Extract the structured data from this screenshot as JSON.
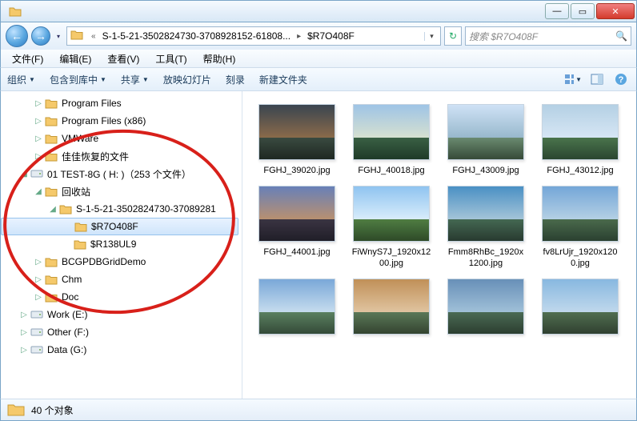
{
  "titlebar": {
    "close": "✕",
    "max": "▭",
    "min": "—"
  },
  "nav": {
    "back": "←",
    "fwd": "→",
    "dropdown": "▾",
    "refresh": "↻",
    "path_sep": "▸",
    "address_parts": [
      "S-1-5-21-3502824730-3708928152-61808...",
      "$R7O408F"
    ],
    "address_dd": "▾"
  },
  "search": {
    "placeholder": "搜索 $R7O408F",
    "icon": "🔍"
  },
  "menu": {
    "file": "文件(F)",
    "edit": "编辑(E)",
    "view": "查看(V)",
    "tools": "工具(T)",
    "help": "帮助(H)"
  },
  "toolbar": {
    "organize": "组织",
    "include": "包含到库中",
    "share": "共享",
    "slideshow": "放映幻灯片",
    "burn": "刻录",
    "newfolder": "新建文件夹",
    "dd": "▼"
  },
  "tree": [
    {
      "indent": 1,
      "expander": "▷",
      "icon": "folder",
      "label": "Program Files"
    },
    {
      "indent": 1,
      "expander": "▷",
      "icon": "folder",
      "label": "Program Files (x86)"
    },
    {
      "indent": 1,
      "expander": "▷",
      "icon": "folder",
      "label": "VMWare"
    },
    {
      "indent": 1,
      "expander": "▷",
      "icon": "folder",
      "label": "佳佳恢复的文件"
    },
    {
      "indent": 0,
      "expander": "◢",
      "icon": "drive",
      "label": "01 TEST-8G ( H: )（253 个文件）"
    },
    {
      "indent": 1,
      "expander": "◢",
      "icon": "folder",
      "label": "回收站"
    },
    {
      "indent": 2,
      "expander": "◢",
      "icon": "folder",
      "label": "S-1-5-21-3502824730-37089281"
    },
    {
      "indent": 3,
      "expander": "",
      "icon": "folder",
      "label": "$R7O408F",
      "selected": true
    },
    {
      "indent": 3,
      "expander": "",
      "icon": "folder",
      "label": "$R138UL9"
    },
    {
      "indent": 1,
      "expander": "▷",
      "icon": "folder",
      "label": "BCGPDBGridDemo"
    },
    {
      "indent": 1,
      "expander": "▷",
      "icon": "folder",
      "label": "Chm"
    },
    {
      "indent": 1,
      "expander": "▷",
      "icon": "folder",
      "label": "Doc"
    },
    {
      "indent": 0,
      "expander": "▷",
      "icon": "drive",
      "label": "Work (E:)"
    },
    {
      "indent": 0,
      "expander": "▷",
      "icon": "drive",
      "label": "Other (F:)"
    },
    {
      "indent": 0,
      "expander": "▷",
      "icon": "drive",
      "label": "Data (G:)"
    }
  ],
  "items": [
    {
      "name": "FGHJ_39020.jpg",
      "sky": "linear-gradient(180deg,#3a4550,#8a6a4a)",
      "land": "linear-gradient(180deg,#3a4a40,#1e2822)"
    },
    {
      "name": "FGHJ_40018.jpg",
      "sky": "linear-gradient(180deg,#9ec4e6,#d6e0d0)",
      "land": "linear-gradient(180deg,#3a6044,#1e3a28)"
    },
    {
      "name": "FGHJ_43009.jpg",
      "sky": "linear-gradient(180deg,#cfe2f6,#98b8cc)",
      "land": "linear-gradient(180deg,#6a8a70,#364a38)"
    },
    {
      "name": "FGHJ_43012.jpg",
      "sky": "linear-gradient(180deg,#b4d0e4,#d6e6f4)",
      "land": "linear-gradient(180deg,#4a744c,#2a4630)"
    },
    {
      "name": "FGHJ_44001.jpg",
      "sky": "linear-gradient(180deg,#6880b8,#b89070)",
      "land": "linear-gradient(180deg,#3a3442,#201e28)"
    },
    {
      "name": "FiWnyS7J_1920x1200.jpg",
      "sky": "linear-gradient(180deg,#8fc3f0,#d8ecfb)",
      "land": "linear-gradient(180deg,#4f7d42,#2e4a28)"
    },
    {
      "name": "Fmm8RhBc_1920x1200.jpg",
      "sky": "linear-gradient(180deg,#4a90c4,#a4c4d8)",
      "land": "linear-gradient(180deg,#446852,#283a30)"
    },
    {
      "name": "fv8LrUjr_1920x1200.jpg",
      "sky": "linear-gradient(180deg,#74a6d8,#b4d0e4)",
      "land": "linear-gradient(180deg,#4a6a4c,#2a4030)"
    },
    {
      "name": "",
      "sky": "linear-gradient(180deg,#7aa8d8,#c6dcee)",
      "land": "linear-gradient(180deg,#5a8060,#344a38)"
    },
    {
      "name": "",
      "sky": "linear-gradient(180deg,#c09058,#e0c4a0)",
      "land": "linear-gradient(180deg,#5a7858,#344430)"
    },
    {
      "name": "",
      "sky": "linear-gradient(180deg,#6890b8,#a0c0d8)",
      "land": "linear-gradient(180deg,#4a6a54,#2c3e30)"
    },
    {
      "name": "",
      "sky": "linear-gradient(180deg,#88b8e0,#c0d8ec)",
      "land": "linear-gradient(180deg,#506e50,#304030)"
    }
  ],
  "status": {
    "count": "40 个对象"
  }
}
